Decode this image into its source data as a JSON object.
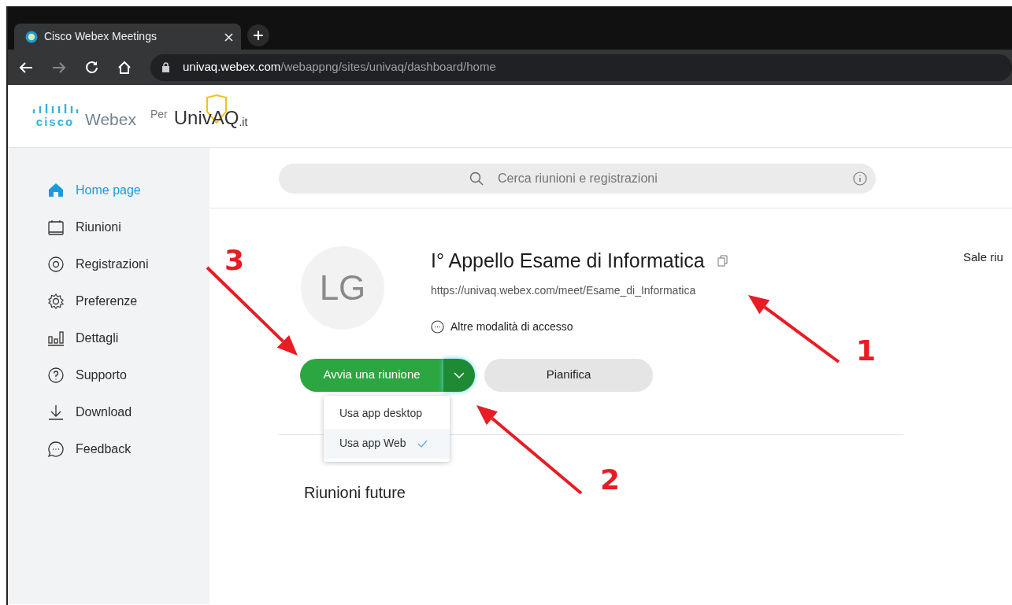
{
  "browser": {
    "tab_title": "Cisco Webex Meetings",
    "url_host": "univaq.webex.com",
    "url_path": "/webappng/sites/univaq/dashboard/home"
  },
  "header": {
    "brand": "cisco",
    "product": "Webex",
    "per": "Per",
    "partner": "UnivAQ",
    "partner_suffix": ".it"
  },
  "sidebar": {
    "items": [
      {
        "label": "Home page",
        "kind": "home",
        "selected": true
      },
      {
        "label": "Riunioni",
        "kind": "calendar",
        "selected": false
      },
      {
        "label": "Registrazioni",
        "kind": "record",
        "selected": false
      },
      {
        "label": "Preferenze",
        "kind": "gear",
        "selected": false
      },
      {
        "label": "Dettagli",
        "kind": "chart",
        "selected": false
      },
      {
        "label": "Supporto",
        "kind": "help",
        "selected": false
      },
      {
        "label": "Download",
        "kind": "download",
        "selected": false
      },
      {
        "label": "Feedback",
        "kind": "chat",
        "selected": false
      }
    ]
  },
  "search": {
    "placeholder": "Cerca riunioni e registrazioni"
  },
  "meeting": {
    "avatar": "LG",
    "title": "I° Appello Esame di Informatica",
    "url": "https://univaq.webex.com/meet/Esame_di_Informatica",
    "access": "Altre modalità di accesso",
    "start_button": "Avvia una riunione",
    "schedule_button": "Pianifica",
    "menu": [
      {
        "label": "Usa app desktop",
        "selected": false
      },
      {
        "label": "Usa app Web",
        "selected": true
      }
    ]
  },
  "upcoming_heading": "Riunioni future",
  "right_column": "Sale riu",
  "annotations": [
    {
      "label": "3"
    },
    {
      "label": "1"
    },
    {
      "label": "2"
    }
  ]
}
